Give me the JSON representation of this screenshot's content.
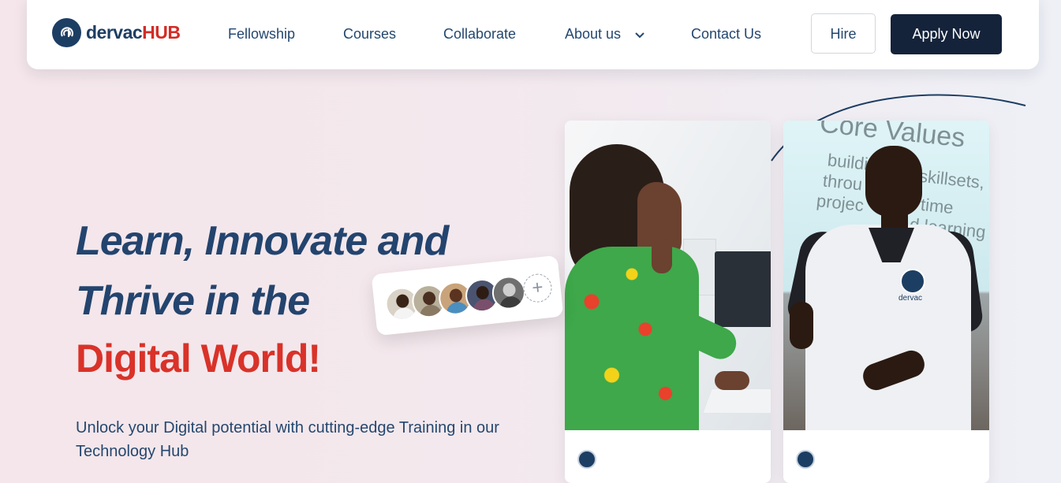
{
  "brand": {
    "name_part1": "dervac",
    "name_part2": "HUB",
    "dark": "#1d3e63",
    "red": "#d32c25"
  },
  "nav": {
    "links": [
      "Fellowship",
      "Courses",
      "Collaborate",
      "About us",
      "Contact Us"
    ],
    "hire_label": "Hire",
    "apply_label": "Apply Now"
  },
  "hero": {
    "line1": "Learn, Innovate and",
    "line2": "Thrive in the",
    "line3": "Digital World!",
    "subtitle": "Unlock your Digital potential with cutting-edge Training in our Technology Hub",
    "plus_symbol": "+"
  },
  "cards": {
    "card2_screen_title": "Core Values",
    "card2_screen_lines": [
      "buildi",
      "skillsets,",
      "throu",
      "time",
      "projec",
      "d learning"
    ],
    "card2_shirt_logo_text": "dervac"
  },
  "icons": [
    "logo-mark-icon",
    "chevron-down-icon",
    "plus-icon",
    "card-logo-icon"
  ],
  "colors": {
    "heading": "#23446e",
    "heading_red": "#d93229",
    "apply_bg": "#14233a"
  }
}
